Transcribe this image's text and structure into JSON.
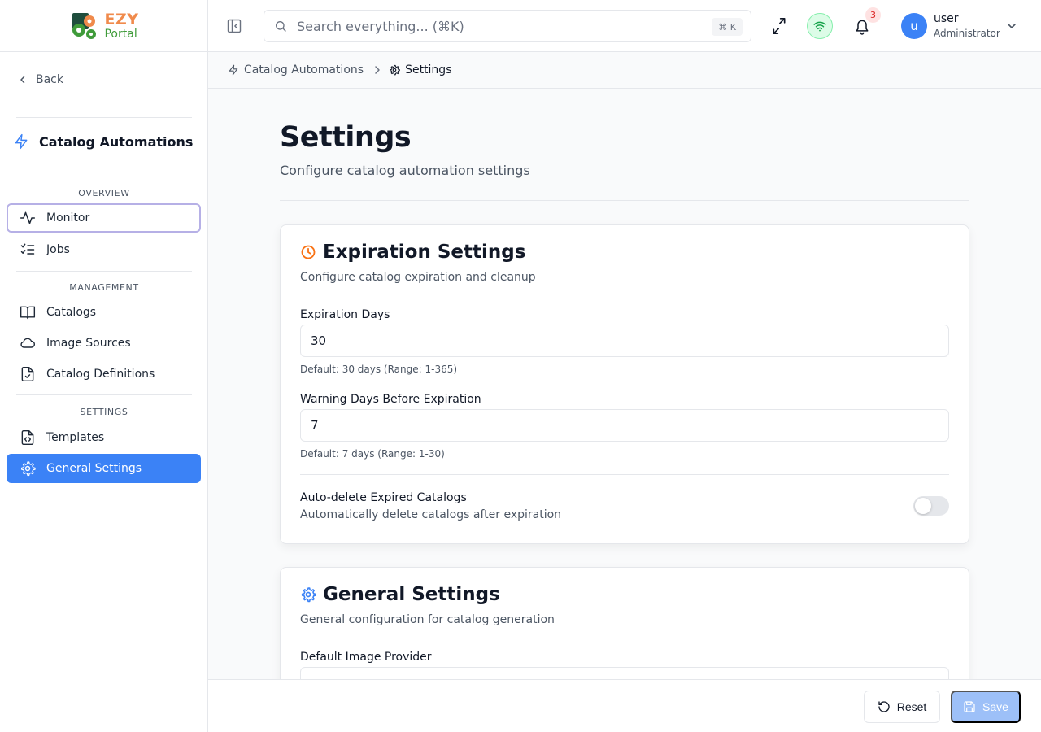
{
  "app": {
    "logo_primary": "EZY",
    "logo_secondary": "Portal"
  },
  "colors": {
    "accent": "#3b82f6",
    "clock_icon": "#f97316",
    "settings_icon": "#3b82f6",
    "wifi_status": "#16a34a"
  },
  "sidebar": {
    "back_label": "Back",
    "section_title": "Catalog Automations",
    "groups": {
      "overview": "OVERVIEW",
      "management": "MANAGEMENT",
      "settings": "SETTINGS"
    },
    "items": {
      "monitor": "Monitor",
      "jobs": "Jobs",
      "catalogs": "Catalogs",
      "image_sources": "Image Sources",
      "catalog_definitions": "Catalog Definitions",
      "templates": "Templates",
      "general_settings": "General Settings"
    }
  },
  "header": {
    "search_placeholder": "Search everything... (⌘K)",
    "search_shortcut": "⌘ K",
    "notification_count": "3",
    "avatar_letter": "u",
    "user_name": "user",
    "user_role": "Administrator"
  },
  "breadcrumb": {
    "parent": "Catalog Automations",
    "current": "Settings"
  },
  "page": {
    "title": "Settings",
    "subtitle": "Configure catalog automation settings"
  },
  "expiration": {
    "title": "Expiration Settings",
    "subtitle": "Configure catalog expiration and cleanup",
    "expiration_days_label": "Expiration Days",
    "expiration_days_value": "30",
    "expiration_days_hint": "Default: 30 days (Range: 1-365)",
    "warning_days_label": "Warning Days Before Expiration",
    "warning_days_value": "7",
    "warning_days_hint": "Default: 7 days (Range: 1-30)",
    "auto_delete_label": "Auto-delete Expired Catalogs",
    "auto_delete_desc": "Automatically delete catalogs after expiration",
    "auto_delete_enabled": false
  },
  "general": {
    "title": "General Settings",
    "subtitle": "General configuration for catalog generation",
    "default_provider_label": "Default Image Provider"
  },
  "footer": {
    "reset_label": "Reset",
    "save_label": "Save"
  }
}
